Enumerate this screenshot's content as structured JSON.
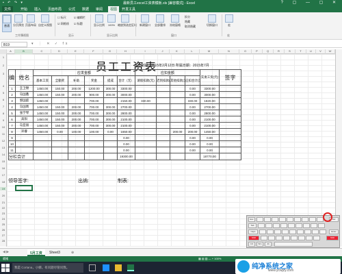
{
  "window": {
    "title": "最新员工excel工资表模板.xls [兼容模式] - Excel",
    "quick_access": "▪ ↶ ↷ ▾",
    "controls": "? ▢ — ▢ ✕"
  },
  "ribbon_tabs": [
    "文件",
    "开始",
    "插入",
    "页面布局",
    "公式",
    "数据",
    "审阅",
    "视图",
    "开发工具"
  ],
  "active_tab": "视图",
  "ribbon": {
    "views": [
      "普通",
      "分页预览",
      "页面布局",
      "自定义视图"
    ],
    "show": [
      "标尺",
      "编辑栏",
      "网格线",
      "标题"
    ],
    "zoom": [
      "显示比例",
      "100%",
      "缩放到选定区域"
    ],
    "window": [
      "新建窗口",
      "全部重排",
      "冻结窗格"
    ],
    "window_small": [
      "拆分",
      "隐藏",
      "取消隐藏"
    ],
    "switch": "切换窗口",
    "macro": "宏",
    "groups": [
      "工作簿视图",
      "显示",
      "显示比例",
      "窗口",
      "宏"
    ]
  },
  "formula_bar": {
    "name_box": "B19",
    "icons": "▾ ⋮ ✕ ✓ fx",
    "value": ""
  },
  "columns": [
    "A",
    "B",
    "C",
    "D",
    "E",
    "F",
    "G",
    "H",
    "I",
    "J",
    "K",
    "L",
    "M",
    "N",
    "O",
    "P",
    "Q",
    "R",
    "S",
    "T",
    "U",
    "V",
    "W"
  ],
  "rows": [
    "1",
    "2",
    "3",
    "4",
    "5",
    "6",
    "7",
    "8",
    "9",
    "10",
    "11",
    "12",
    "13",
    "14",
    "15",
    "16",
    "17",
    "18",
    "19",
    "20",
    "21",
    "22",
    "23",
    "24",
    "25",
    "26",
    "27",
    "28",
    "29",
    "30",
    "31",
    "32"
  ],
  "sheet": {
    "title": "员工工资表",
    "issue_date": "发放日期：2015年2月12日 所属日期：2015年7月",
    "headers": {
      "seq": "编号",
      "name": "姓名",
      "payable_group": "应发金额",
      "deduct_group": "应扣金额",
      "net": "实发工资(元)",
      "sign": "签字",
      "payable": [
        "基本工资",
        "全勤奖",
        "补助",
        "奖金",
        "提成",
        "合计（元）"
      ],
      "deduct": [
        "请假扣款(元)",
        "迟到扣款(元)",
        "其他扣款(元)",
        "应扣合计(元)"
      ]
    },
    "rows": [
      {
        "no": "1",
        "name": "王卫锦",
        "basic": "1450.00",
        "att": "150.00",
        "sub": "200.00",
        "bonus": "1200.00",
        "comm": "300.00",
        "total": "3300.00",
        "leave": "",
        "late": "",
        "other": "",
        "dsum": "0.00",
        "net": "3300.00"
      },
      {
        "no": "2",
        "name": "马国鑫",
        "basic": "1450.00",
        "att": "150.00",
        "sub": "200.00",
        "bonus": "900.00",
        "comm": "300.00",
        "total": "3000.00",
        "leave": "",
        "late": "",
        "other": "",
        "dsum": "0.00",
        "net": "3000.00"
      },
      {
        "no": "3",
        "name": "郭国庭",
        "basic": "1450.00",
        "att": "",
        "sub": "",
        "bonus": "700.00",
        "comm": "",
        "total": "2150.00",
        "leave": "330.00",
        "late": "",
        "other": "",
        "dsum": "330.00",
        "net": "1820.00"
      },
      {
        "no": "4",
        "name": "马国南",
        "basic": "1450.00",
        "att": "150.00",
        "sub": "200.00",
        "bonus": "700.00",
        "comm": "300.00",
        "total": "2700.00",
        "leave": "",
        "late": "",
        "other": "",
        "dsum": "0.00",
        "net": "2700.00"
      },
      {
        "no": "5",
        "name": "张学琴",
        "basic": "1450.00",
        "att": "150.00",
        "sub": "200.00",
        "bonus": "700.00",
        "comm": "300.00",
        "total": "2800.00",
        "leave": "",
        "late": "",
        "other": "",
        "dsum": "0.00",
        "net": "2800.00"
      },
      {
        "no": "6",
        "name": "高阳",
        "basic": "1450.00",
        "att": "150.00",
        "sub": "200.00",
        "bonus": "700.00",
        "comm": "300.00",
        "total": "2100.00",
        "leave": "",
        "late": "",
        "other": "",
        "dsum": "0.00",
        "net": "2100.00"
      },
      {
        "no": "7",
        "name": "马亚丽",
        "basic": "1450.00",
        "att": "150.00",
        "sub": "200.00",
        "bonus": "700.00",
        "comm": "300.00",
        "total": "2100.00",
        "leave": "",
        "late": "",
        "other": "",
        "dsum": "0.00",
        "net": "2100.00"
      },
      {
        "no": "8",
        "name": "邓睿",
        "basic": "1450.00",
        "att": "0.00",
        "sub": "100.00",
        "bonus": "100.00",
        "comm": "0.00",
        "total": "1650.00",
        "leave": "",
        "late": "",
        "other": "200.00",
        "dsum": "200.00",
        "net": "1450.00"
      },
      {
        "no": "9",
        "name": "",
        "basic": "",
        "att": "",
        "sub": "",
        "bonus": "",
        "comm": "",
        "total": "0.00",
        "leave": "",
        "late": "",
        "other": "",
        "dsum": "0.00",
        "net": "0.00"
      },
      {
        "no": "10",
        "name": "",
        "basic": "",
        "att": "",
        "sub": "",
        "bonus": "",
        "comm": "",
        "total": "0.00",
        "leave": "",
        "late": "",
        "other": "",
        "dsum": "0.00",
        "net": "0.00"
      },
      {
        "no": "11",
        "name": "",
        "basic": "",
        "att": "",
        "sub": "",
        "bonus": "",
        "comm": "",
        "total": "0.00",
        "leave": "",
        "late": "",
        "other": "",
        "dsum": "0.00",
        "net": "0.00"
      }
    ],
    "subtotal_label": "分栏合计",
    "subtotal_total": "19300.00",
    "subtotal_net": "18770.00",
    "sign_leader": "领导签字:",
    "sign_cashier": "出纳:",
    "sign_maker": "制表:"
  },
  "sheet_tabs": [
    "5月工资",
    "Sheet3"
  ],
  "sheet_add": "⊕",
  "status": {
    "left": "就绪",
    "right": "▦ ▤ ▥ — + 100%"
  },
  "taskbar": {
    "search": "我是 Cortana，小娜。有问题尽管问我。"
  },
  "keyboard": {
    "keys": [
      "Esc",
      "Tab",
      "Caps",
      "Shift",
      "Ctrl",
      "Win",
      "Alt",
      "Enter",
      "Shift",
      "Del"
    ]
  },
  "watermark": {
    "title": "纯净系统之家",
    "url": "www.ycwjzy.com"
  },
  "colors": {
    "excel_green": "#217346",
    "circle": "#e02020",
    "taskbar": "#1c2432"
  }
}
